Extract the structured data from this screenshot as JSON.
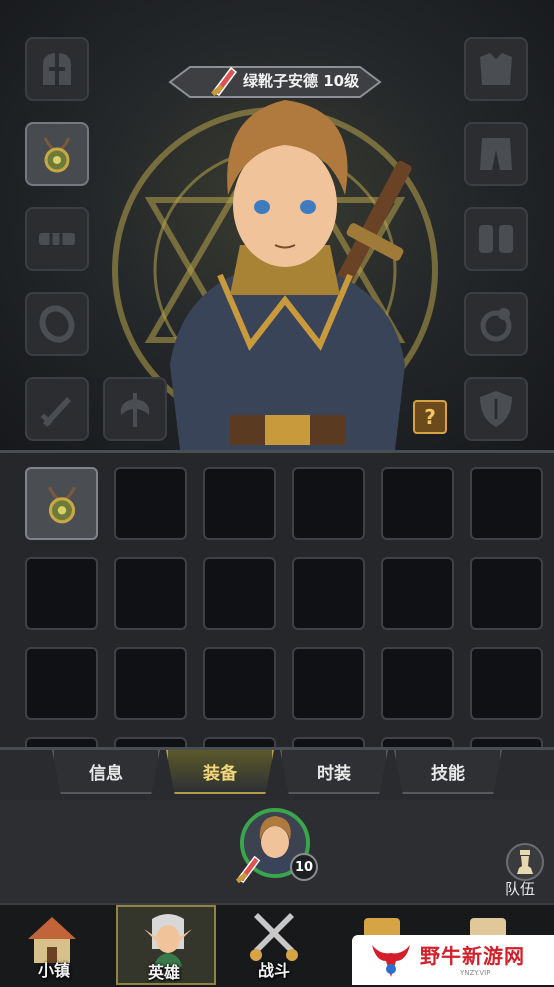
{
  "hero": {
    "name_level": "绿靴子安德 10级",
    "help_symbol": "?"
  },
  "equipment_slots": {
    "left": [
      "helmet",
      "amulet",
      "belt",
      "ring",
      "weapon"
    ],
    "left_extra": "offhand",
    "right": [
      "chest-armor",
      "pants",
      "gloves",
      "ring-2",
      "shield"
    ],
    "filled": "amulet"
  },
  "inventory": {
    "columns": 6,
    "rows": 3,
    "items": [
      "amulet"
    ]
  },
  "tabs": [
    {
      "label": "信息",
      "active": false
    },
    {
      "label": "装备",
      "active": true
    },
    {
      "label": "时装",
      "active": false
    },
    {
      "label": "技能",
      "active": false
    }
  ],
  "selected_hero": {
    "level": "10"
  },
  "team": {
    "label": "队伍"
  },
  "nav": [
    {
      "label": "小镇",
      "active": false
    },
    {
      "label": "英雄",
      "active": true
    },
    {
      "label": "战斗",
      "active": false
    }
  ],
  "watermark": {
    "text": "野牛新游网",
    "url": "YNZY.VIP"
  },
  "colors": {
    "accent_gold": "#d6a445",
    "active_ring": "#3aa64b",
    "watermark_red": "#d31f2a"
  }
}
